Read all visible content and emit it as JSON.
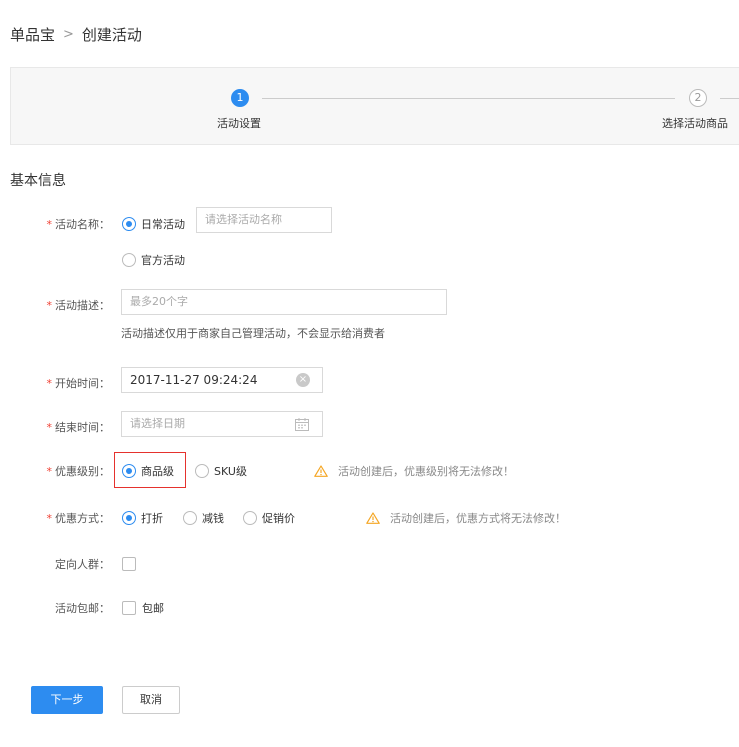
{
  "breadcrumb": {
    "parent": "单品宝",
    "separator": ">",
    "current": "创建活动"
  },
  "steps": [
    {
      "number": "1",
      "label": "活动设置"
    },
    {
      "number": "2",
      "label": "选择活动商品"
    }
  ],
  "section_title": "基本信息",
  "form": {
    "activity_name": {
      "label": "活动名称：",
      "options": [
        "日常活动",
        "官方活动"
      ],
      "selected": "日常活动",
      "input_placeholder": "请选择活动名称"
    },
    "activity_desc": {
      "label": "活动描述：",
      "placeholder": "最多20个字",
      "hint": "活动描述仅用于商家自己管理活动，不会显示给消费者"
    },
    "start_time": {
      "label": "开始时间：",
      "value": "2017-11-27 09:24:24",
      "clear_symbol": "×"
    },
    "end_time": {
      "label": "结束时间：",
      "placeholder": "请选择日期"
    },
    "discount_level": {
      "label": "优惠级别：",
      "options": [
        "商品级",
        "SKU级"
      ],
      "selected": "商品级",
      "warning": "活动创建后，优惠级别将无法修改！"
    },
    "discount_method": {
      "label": "优惠方式：",
      "options": [
        "打折",
        "减钱",
        "促销价"
      ],
      "selected": "打折",
      "warning": "活动创建后，优惠方式将无法修改！"
    },
    "target_group": {
      "label": "定向人群："
    },
    "free_shipping": {
      "label": "活动包邮：",
      "option": "包邮"
    }
  },
  "buttons": {
    "next": "下一步",
    "cancel": "取消"
  },
  "colors": {
    "primary": "#2d8cf0",
    "required": "#f04134",
    "highlight": "#e5322d",
    "warning": "#f5a623"
  },
  "icons": {
    "warning": "warning-triangle-icon",
    "clear": "clear-circle-icon",
    "calendar": "calendar-icon"
  }
}
